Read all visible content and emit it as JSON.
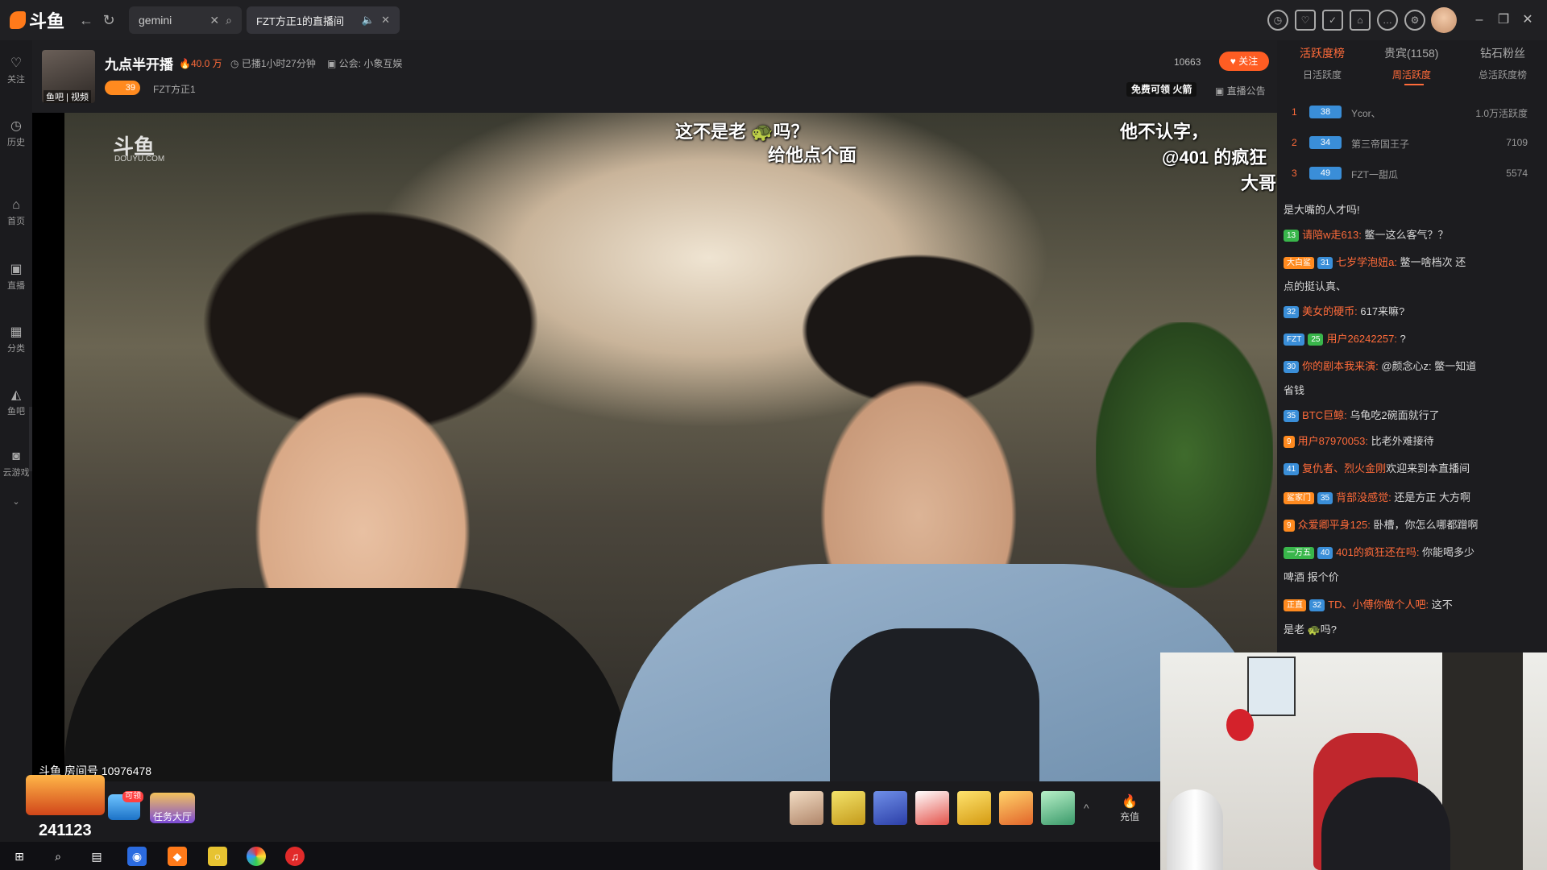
{
  "browser": {
    "search_tab_label": "gemini",
    "live_tab_label": "FZT方正1的直播间"
  },
  "leftnav": {
    "items": [
      {
        "label": "关注"
      },
      {
        "label": "历史"
      },
      {
        "label": "首页"
      },
      {
        "label": "直播"
      },
      {
        "label": "分类"
      },
      {
        "label": "鱼吧"
      },
      {
        "label": "云游戏"
      }
    ]
  },
  "room": {
    "title": "九点半开播",
    "hot": "40.0 万",
    "duration": "已播1小时27分钟",
    "guild": "公会: 小象互娱",
    "level": "39",
    "fan_name": "FZT方正1",
    "avatar_tag": "鱼吧 | 视频",
    "follower_count": "10663",
    "follow_label": "关注",
    "free_gift": "免费可领 火箭",
    "announce": "直播公告"
  },
  "video": {
    "watermark": "斗鱼",
    "watermark_sub": "DOUYU.COM",
    "danmu": [
      {
        "text": "这不是老 🐢吗？"
      },
      {
        "text": "给他点个面"
      },
      {
        "text": "他不认字，"
      },
      {
        "text": "@401 的疯狂"
      },
      {
        "text": "大哥"
      }
    ],
    "room_id_label": "斗鱼 房间号 10976478",
    "big_count": "241123"
  },
  "bottom": {
    "task_label": "任务大厅",
    "charge_label": "充值",
    "claim_label": "可领"
  },
  "rightpanel": {
    "tabs": [
      {
        "label": "活跃度榜"
      },
      {
        "label": "贵宾(1158)"
      },
      {
        "label": "钻石粉丝"
      }
    ],
    "subtabs": [
      {
        "label": "日活跃度"
      },
      {
        "label": "周活跃度"
      },
      {
        "label": "总活跃度榜"
      }
    ],
    "ranks": [
      {
        "no": "1",
        "lv": "38",
        "name": "Ycor、",
        "val": "1.0万活跃度"
      },
      {
        "no": "2",
        "lv": "34",
        "name": "第三帝国王子",
        "val": "7109"
      },
      {
        "no": "3",
        "lv": "49",
        "name": "FZT一甜瓜",
        "val": "5574"
      }
    ],
    "chat": [
      {
        "badge": "",
        "user": "",
        "msg": "是大嘴的人才吗!"
      },
      {
        "badge": "13",
        "user": "请陪w走613:",
        "msg": " 鳖一这么客气？？"
      },
      {
        "badge": "31",
        "user": "七岁学泡妞a:",
        "msg": " 鳖一啥档次 还"
      },
      {
        "badge": "",
        "user": "",
        "msg": "点的挺认真、"
      },
      {
        "badge": "32",
        "user": "美女的硬币:",
        "msg": " 617来嘛?"
      },
      {
        "badge": "25",
        "user": "用户26242257:",
        "msg": " ?"
      },
      {
        "badge": "30",
        "user": "你的剧本我来演:",
        "msg": " @颜念心z: 鳖一知道"
      },
      {
        "badge": "",
        "user": "",
        "msg": "省钱"
      },
      {
        "badge": "35",
        "user": "BTC巨鲸:",
        "msg": " 乌龟吃2碗面就行了"
      },
      {
        "badge": "9",
        "user": "用户87970053:",
        "msg": " 比老外难接待"
      },
      {
        "badge": "41",
        "user": "复仇者、烈火金刚",
        "msg": "欢迎来到本直播间"
      },
      {
        "badge": "35",
        "user": "背部没感觉:",
        "msg": " 还是方正 大方啊"
      },
      {
        "badge": "9",
        "user": "众爱卿平身125:",
        "msg": " 卧槽，你怎么哪都蹭啊"
      },
      {
        "badge": "40",
        "user": "401的疯狂还在吗:",
        "msg": " 你能喝多少"
      },
      {
        "badge": "",
        "user": "",
        "msg": "啤酒 报个价"
      },
      {
        "badge": "32",
        "user": "TD、小傅你做个人吧:",
        "msg": " 这不"
      },
      {
        "badge": "",
        "user": "",
        "msg": "是老 🐢吗?"
      }
    ]
  }
}
